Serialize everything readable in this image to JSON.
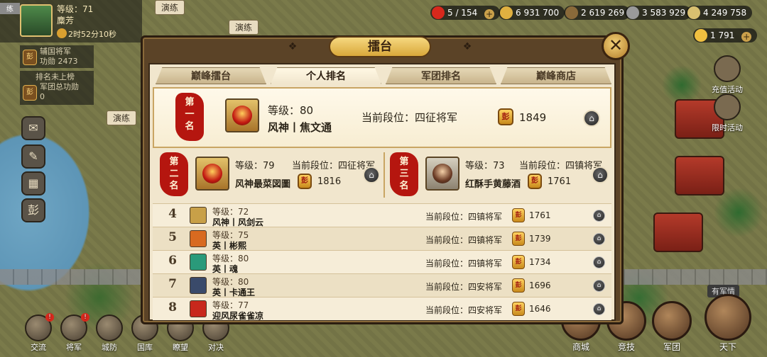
{
  "map": {
    "labels": [
      "演练",
      "演练",
      "演练"
    ],
    "alert_label": "有军情"
  },
  "player": {
    "home_tag": "练",
    "level": "等级：71",
    "name": "麋芳",
    "timer": "2时52分10秒"
  },
  "side_info": [
    {
      "line1": "辅国将军",
      "line2": "功勋   2473"
    },
    {
      "line1": "排名未上榜",
      "line2": "军团总功勋",
      "line3": "0"
    }
  ],
  "resources": [
    {
      "value": "5 / 154",
      "icon": "flag-icon",
      "color": "#d8281c"
    },
    {
      "value": "6 931 700",
      "icon": "gold-coin-icon",
      "color": "#e0b040"
    },
    {
      "value": "2 619 269",
      "icon": "lumber-icon",
      "color": "#8a6a3a"
    },
    {
      "value": "3 583 929",
      "icon": "stone-icon",
      "color": "#9a9a9a"
    },
    {
      "value": "4 249 758",
      "icon": "grain-icon",
      "color": "#d9c070"
    },
    {
      "value": "1 791",
      "icon": "ingot-icon",
      "color": "#f0c040"
    }
  ],
  "right_actions": [
    {
      "label": "充值活动",
      "icon": "gold-ingot-icon"
    },
    {
      "label": "限时活动",
      "icon": "hourglass-icon"
    }
  ],
  "bottom_left": [
    {
      "label": "交流",
      "icon": "chat-icon",
      "badge": "!"
    },
    {
      "label": "将军",
      "icon": "general-icon",
      "badge": "!"
    },
    {
      "label": "城防",
      "icon": "shield-icon",
      "badge": ""
    },
    {
      "label": "国库",
      "icon": "treasury-icon",
      "badge": ""
    },
    {
      "label": "瞭望",
      "icon": "telescope-icon",
      "badge": ""
    },
    {
      "label": "对决",
      "icon": "swords-icon",
      "badge": ""
    }
  ],
  "bottom_right": [
    {
      "label": "商城",
      "icon": "shop-icon"
    },
    {
      "label": "竞技",
      "icon": "arena-icon"
    },
    {
      "label": "军团",
      "icon": "legion-icon"
    },
    {
      "label": "天下",
      "icon": "world-icon"
    }
  ],
  "dialog": {
    "title": "擂台",
    "close_label": "✕",
    "tabs": [
      {
        "label": "巅峰擂台",
        "active": false
      },
      {
        "label": "个人排名",
        "active": true
      },
      {
        "label": "军团排名",
        "active": false
      },
      {
        "label": "巅峰商店",
        "active": false
      }
    ],
    "tier_label": "当前段位：",
    "coin_glyph": "彭",
    "top3": [
      {
        "seal": "第一名",
        "level": "等级：80",
        "name": "风神丨焦文通",
        "tier": "当前段位：四征将军",
        "score": "1849"
      },
      {
        "seal": "第二名",
        "level": "等级：79",
        "name": "风神最菜図圖",
        "tier": "当前段位：四征将军",
        "score": "1816"
      },
      {
        "seal": "第三名",
        "level": "等级：73",
        "name": "红酥手黄藤酒",
        "tier": "当前段位：四镇将军",
        "score": "1761"
      }
    ],
    "ranks": [
      {
        "rank": "4",
        "level": "等级：72",
        "name": "风神丨风剑云",
        "tier": "当前段位：四镇将军",
        "score": "1761",
        "icon_color": "#c8a048"
      },
      {
        "rank": "5",
        "level": "等级：75",
        "name": "英丨彬熙",
        "tier": "当前段位：四镇将军",
        "score": "1739",
        "icon_color": "#d86a20"
      },
      {
        "rank": "6",
        "level": "等级：80",
        "name": "英丨魂",
        "tier": "当前段位：四镇将军",
        "score": "1734",
        "icon_color": "#2a9a7a"
      },
      {
        "rank": "7",
        "level": "等级：80",
        "name": "英丨卡通王",
        "tier": "当前段位：四安将军",
        "score": "1696",
        "icon_color": "#3a4a6a"
      },
      {
        "rank": "8",
        "level": "等级：77",
        "name": "迎风尿雀雀凉",
        "tier": "当前段位：四安将军",
        "score": "1646",
        "icon_color": "#c8281c"
      }
    ]
  }
}
